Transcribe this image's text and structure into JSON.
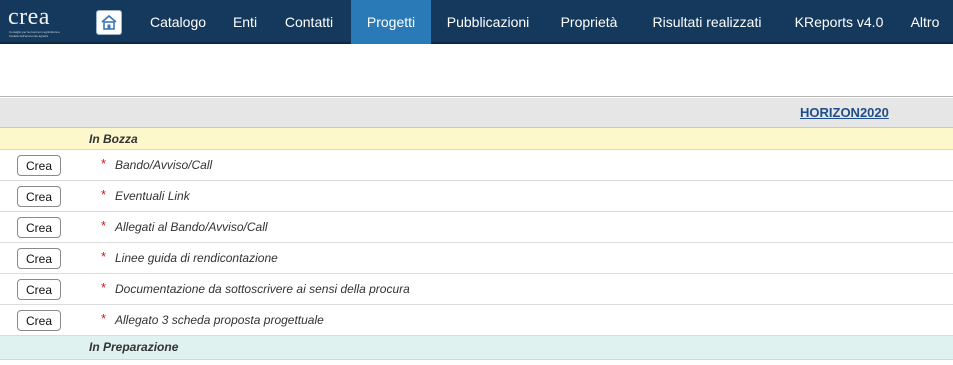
{
  "logo": {
    "text": "crea",
    "subtitle": "Consiglio per la ricerca in agricoltura e l'analisi dell'economia agraria"
  },
  "nav": {
    "items": [
      {
        "label": "Catalogo"
      },
      {
        "label": "Enti"
      },
      {
        "label": "Contatti"
      },
      {
        "label": "Progetti",
        "active": true
      },
      {
        "label": "Pubblicazioni"
      },
      {
        "label": "Proprietà"
      },
      {
        "label": "Risultati realizzati"
      },
      {
        "label": "KReports v4.0"
      },
      {
        "label": "Altro"
      }
    ]
  },
  "header": {
    "link": "HORIZON2020"
  },
  "sections": {
    "bozza": "In Bozza",
    "preparazione": "In Preparazione"
  },
  "rows": [
    {
      "button": "Crea",
      "required": "*",
      "label": "Bando/Avviso/Call"
    },
    {
      "button": "Crea",
      "required": "*",
      "label": "Eventuali Link"
    },
    {
      "button": "Crea",
      "required": "*",
      "label": "Allegati al Bando/Avviso/Call"
    },
    {
      "button": "Crea",
      "required": "*",
      "label": "Linee guida di rendicontazione"
    },
    {
      "button": "Crea",
      "required": "*",
      "label": "Documentazione da sottoscrivere ai sensi della procura"
    },
    {
      "button": "Crea",
      "required": "*",
      "label": "Allegato 3 scheda proposta progettuale"
    }
  ],
  "colors": {
    "navbar": "#14395c",
    "nav_active": "#2a7ab8",
    "bozza_bg": "#fdf8cc",
    "prep_bg": "#dff2ef",
    "link": "#1f4e8a",
    "required": "#d01818"
  },
  "icons": {
    "home": "home-icon"
  }
}
